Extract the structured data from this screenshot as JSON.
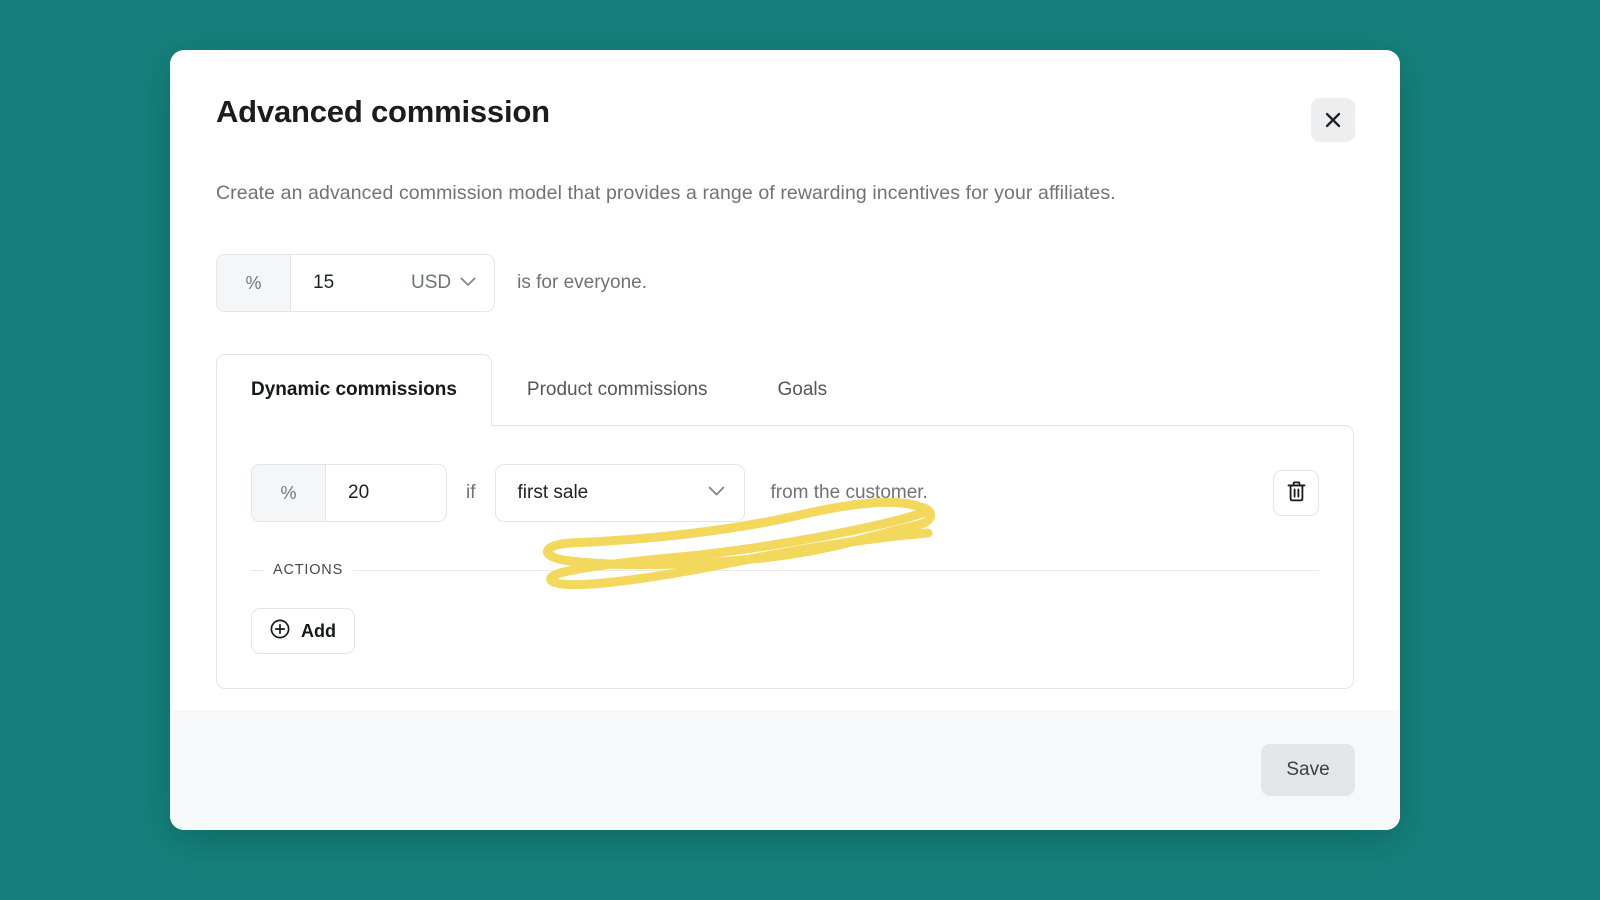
{
  "theme": {
    "background_color": "#15807B",
    "card_color": "#FFFFFF",
    "footer_color": "#F7F8F9",
    "border_color": "#E3E5E8",
    "highlight_color": "#F5D960",
    "text_primary": "#1A1C1E",
    "text_muted": "#6E7378"
  },
  "modal": {
    "title": "Advanced commission",
    "subtitle": "Create an advanced commission model that provides a range of rewarding incentives for your affiliates.",
    "close_icon": "close-icon"
  },
  "base_rate": {
    "unit_prefix": "%",
    "value": "15",
    "placeholder": "0",
    "currency": "USD",
    "currency_chevron_icon": "chevron-down-icon",
    "sentence_tail": "is for everyone."
  },
  "tabs": [
    {
      "label": "Dynamic commissions",
      "active": true
    },
    {
      "label": "Product commissions",
      "active": false
    },
    {
      "label": "Goals",
      "active": false
    }
  ],
  "rule": {
    "unit_prefix": "%",
    "value": "20",
    "placeholder": "0",
    "condition_label": "if",
    "condition_value": "first sale",
    "condition_chevron_icon": "chevron-down-icon",
    "sentence_tail": "from the customer.",
    "delete_icon": "trash-icon"
  },
  "actions": {
    "section_label": "ACTIONS",
    "add_label": "Add",
    "add_icon": "plus-circle-icon"
  },
  "footer": {
    "save_label": "Save"
  },
  "annotation": {
    "type": "highlighter-scribble",
    "color": "#F5D960"
  }
}
